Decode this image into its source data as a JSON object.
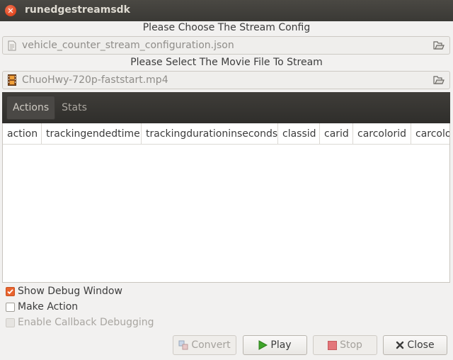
{
  "window": {
    "title": "runedgestreamsdk"
  },
  "config": {
    "label": "Please Choose The Stream Config",
    "value": "vehicle_counter_stream_configuration.json"
  },
  "movie": {
    "label": "Please Select The Movie File To Stream",
    "value": "ChuoHwy-720p-faststart.mp4"
  },
  "tabs": [
    {
      "label": "Actions",
      "active": true
    },
    {
      "label": "Stats",
      "active": false
    }
  ],
  "table": {
    "columns": [
      "action",
      "trackingendedtime",
      "trackingdurationinseconds",
      "classid",
      "carid",
      "carcolorid",
      "carcolo"
    ]
  },
  "options": [
    {
      "label": "Show Debug Window",
      "checked": true,
      "enabled": true
    },
    {
      "label": "Make Action",
      "checked": false,
      "enabled": true
    },
    {
      "label": "Enable Callback Debugging",
      "checked": false,
      "enabled": false
    }
  ],
  "buttons": {
    "convert": "Convert",
    "play": "Play",
    "stop": "Stop",
    "close": "Close"
  },
  "colors": {
    "accent": "#e9642f",
    "play_green": "#3fa52a",
    "stop_red": "#e3767a"
  }
}
